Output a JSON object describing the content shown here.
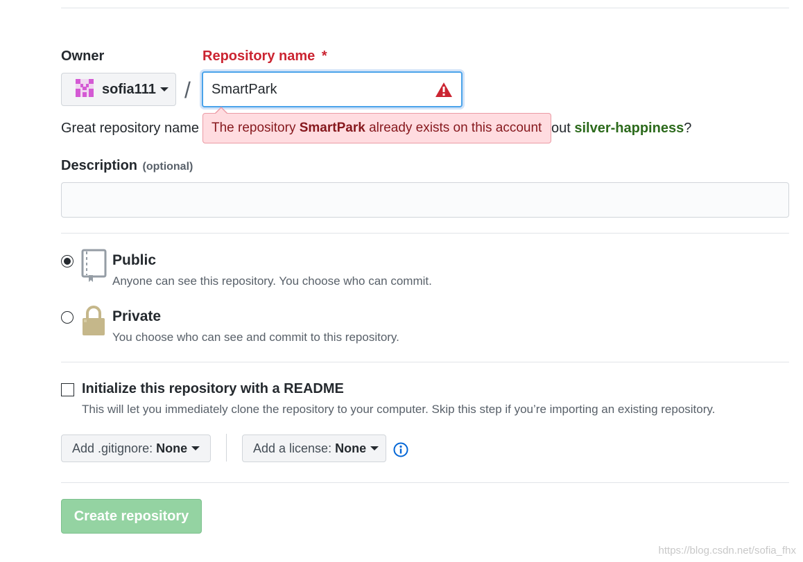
{
  "owner": {
    "label": "Owner",
    "username": "sofia111"
  },
  "repo_name": {
    "label": "Repository name",
    "required_mark": "*",
    "value": "SmartPark"
  },
  "separator": "/",
  "error": {
    "prefix": "The repository ",
    "name": "SmartPark",
    "suffix": " already exists on this account"
  },
  "hint": {
    "before": "Great repository name",
    "after": "out ",
    "suggestion": "silver-happiness",
    "end": "?"
  },
  "description": {
    "label": "Description",
    "optional": "(optional)",
    "value": ""
  },
  "visibility": {
    "public": {
      "title": "Public",
      "desc": "Anyone can see this repository. You choose who can commit.",
      "selected": true
    },
    "private": {
      "title": "Private",
      "desc": "You choose who can see and commit to this repository.",
      "selected": false
    }
  },
  "readme": {
    "title": "Initialize this repository with a README",
    "desc": "This will let you immediately clone the repository to your computer. Skip this step if you’re importing an existing repository.",
    "checked": false
  },
  "gitignore": {
    "label": "Add .gitignore:",
    "value": "None"
  },
  "license": {
    "label": "Add a license:",
    "value": "None"
  },
  "create_button": "Create repository",
  "watermark": "https://blog.csdn.net/sofia_fhx",
  "colors": {
    "error_text": "#cb2431",
    "suggestion": "#2c6a1c",
    "create_button": "#94d3a2",
    "focus_border": "#4aa3ea"
  }
}
